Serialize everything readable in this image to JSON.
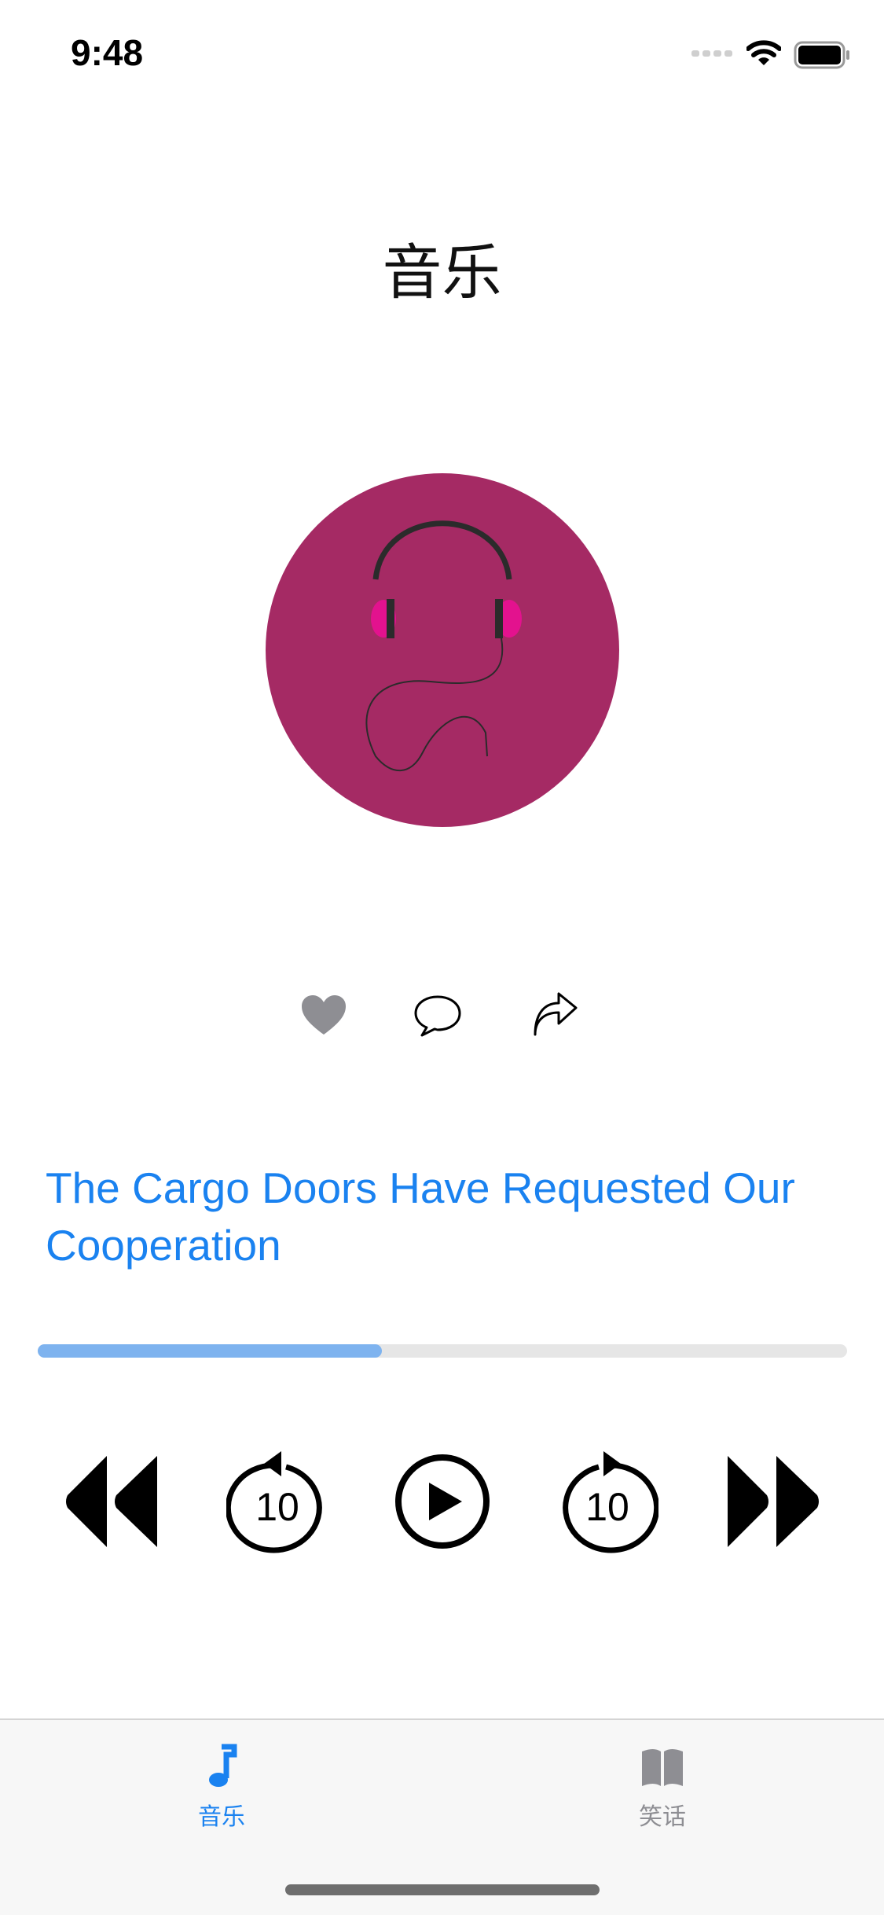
{
  "status_bar": {
    "time": "9:48"
  },
  "page": {
    "title": "音乐"
  },
  "actions": {
    "like_icon": "heart-icon",
    "comment_icon": "speech-bubble-icon",
    "share_icon": "share-arrow-icon"
  },
  "song": {
    "title": "The Cargo Doors Have Requested Our Cooperation"
  },
  "playback": {
    "progress": 0.425
  },
  "controls": {
    "skip_back_label": "10",
    "skip_forward_label": "10"
  },
  "tab_bar": {
    "items": [
      {
        "label": "音乐",
        "icon": "music-note-icon",
        "active": true
      },
      {
        "label": "笑话",
        "icon": "book-icon",
        "active": false
      }
    ]
  },
  "colors": {
    "accent": "#1a82f0",
    "album_background": "#a52a64",
    "headphone_cups": "#e3128e",
    "progress_fill": "#7eb3ef",
    "progress_track": "#e6e6e6",
    "inactive_tab": "#8e8e93"
  }
}
